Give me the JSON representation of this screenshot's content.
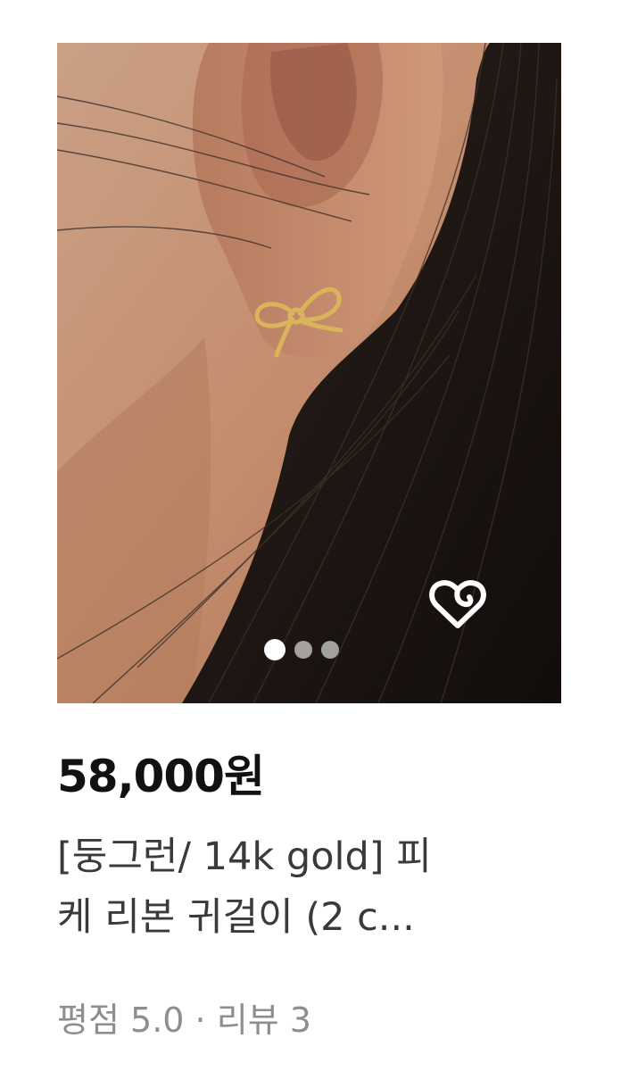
{
  "product": {
    "price": "58,000원",
    "title_line1": "[둥그런/ 14k gold] 피",
    "title_line2": "케 리본 귀걸이 (2 c...",
    "rating_label": "평점",
    "rating_value": "5.0",
    "separator": "·",
    "review_label": "리뷰",
    "review_count": "3"
  },
  "image": {
    "carousel_total": 3,
    "carousel_active": 1,
    "wish_icon": "heart-outline-icon"
  },
  "colors": {
    "price": "#111111",
    "title": "#3a3a3a",
    "meta": "#8e8e8e",
    "skin": "#c08a6b",
    "hair": "#1c1613",
    "gold": "#d9b45a"
  }
}
